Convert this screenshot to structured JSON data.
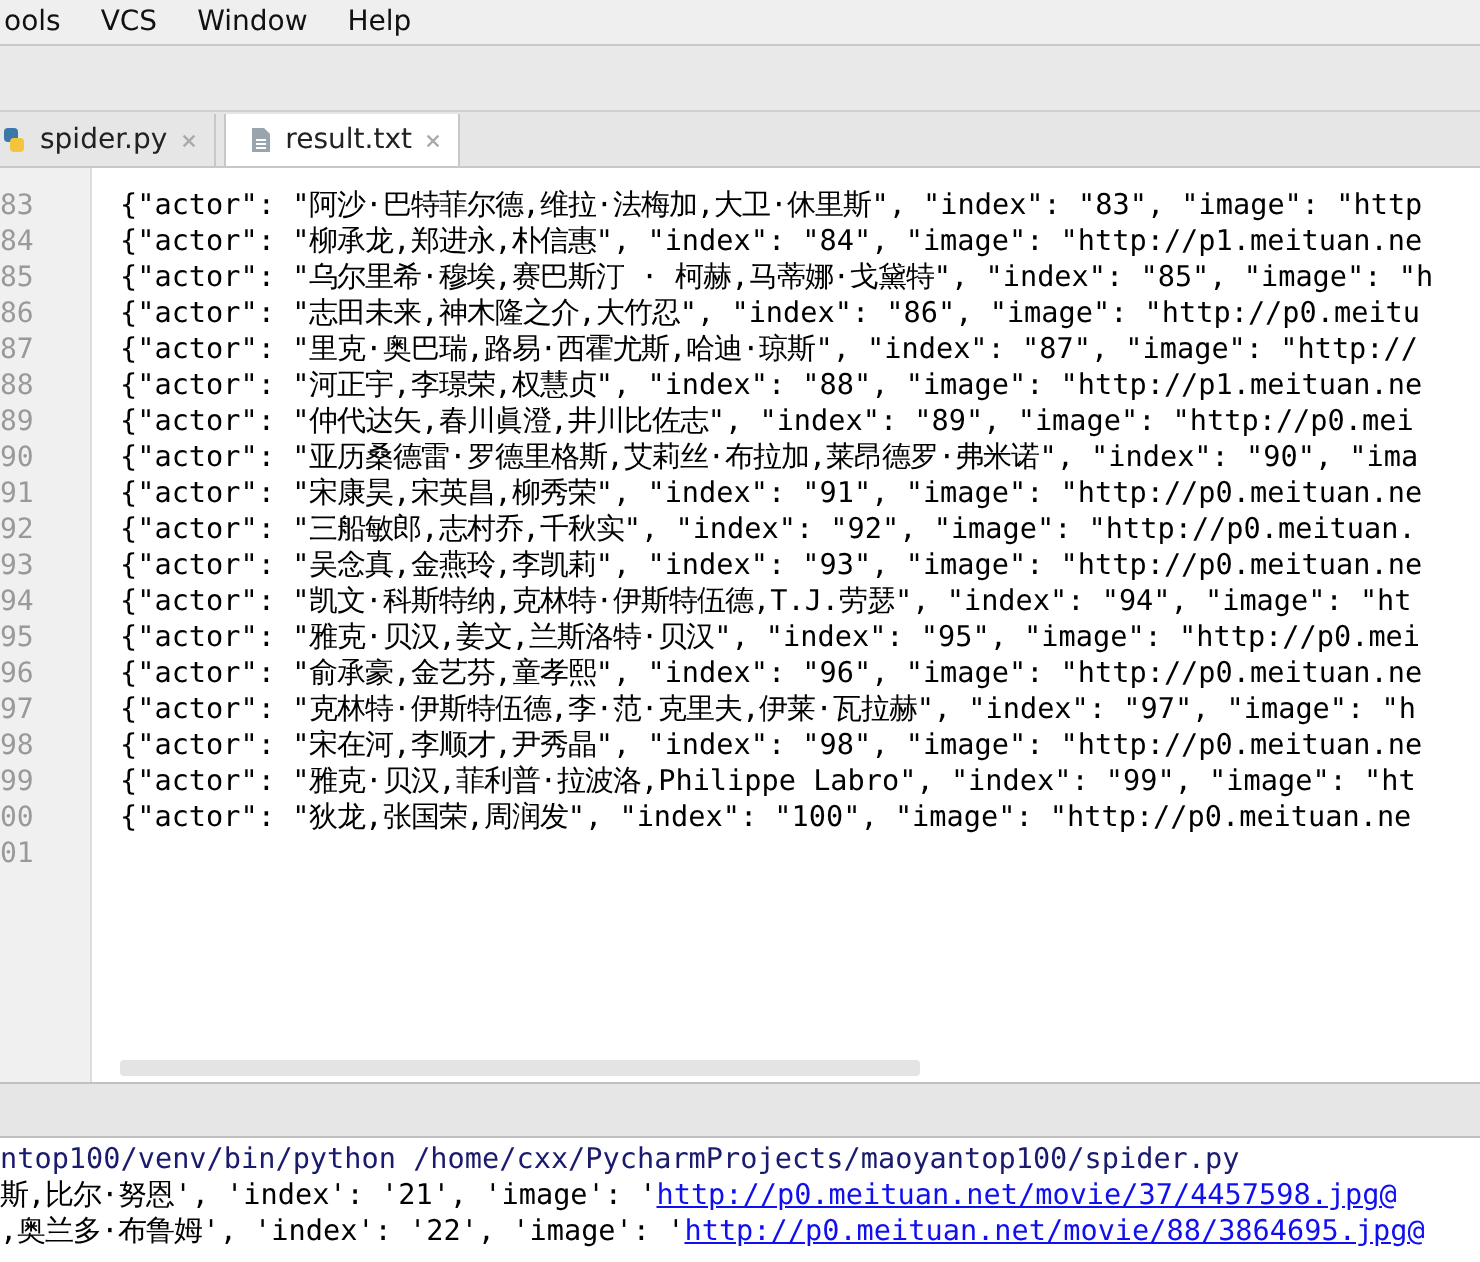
{
  "menu_bar": [
    "ools",
    "VCS",
    "Window",
    "Help"
  ],
  "tabs": [
    {
      "label": "spider.py",
      "kind": "python",
      "selected": false
    },
    {
      "label": "result.txt",
      "kind": "text",
      "selected": true
    }
  ],
  "editor": {
    "lines": [
      {
        "number": "83",
        "text": "{\"actor\": \"阿沙·巴特菲尔德,维拉·法梅加,大卫·休里斯\", \"index\": \"83\", \"image\": \"http"
      },
      {
        "number": "84",
        "text": "{\"actor\": \"柳承龙,郑进永,朴信惠\", \"index\": \"84\", \"image\": \"http://p1.meituan.ne"
      },
      {
        "number": "85",
        "text": "{\"actor\": \"乌尔里希·穆埃,赛巴斯汀 · 柯赫,马蒂娜·戈黛特\", \"index\": \"85\", \"image\": \"h"
      },
      {
        "number": "86",
        "text": "{\"actor\": \"志田未来,神木隆之介,大竹忍\", \"index\": \"86\", \"image\": \"http://p0.meitu"
      },
      {
        "number": "87",
        "text": "{\"actor\": \"里克·奥巴瑞,路易·西霍尤斯,哈迪·琼斯\", \"index\": \"87\", \"image\": \"http://"
      },
      {
        "number": "88",
        "text": "{\"actor\": \"河正宇,李璟荣,权慧贞\", \"index\": \"88\", \"image\": \"http://p1.meituan.ne"
      },
      {
        "number": "89",
        "text": "{\"actor\": \"仲代达矢,春川眞澄,井川比佐志\", \"index\": \"89\", \"image\": \"http://p0.mei"
      },
      {
        "number": "90",
        "text": "{\"actor\": \"亚历桑德雷·罗德里格斯,艾莉丝·布拉加,莱昂德罗·弗米诺\", \"index\": \"90\", \"ima"
      },
      {
        "number": "91",
        "text": "{\"actor\": \"宋康昊,宋英昌,柳秀荣\", \"index\": \"91\", \"image\": \"http://p0.meituan.ne"
      },
      {
        "number": "92",
        "text": "{\"actor\": \"三船敏郎,志村乔,千秋实\", \"index\": \"92\", \"image\": \"http://p0.meituan."
      },
      {
        "number": "93",
        "text": "{\"actor\": \"吴念真,金燕玲,李凯莉\", \"index\": \"93\", \"image\": \"http://p0.meituan.ne"
      },
      {
        "number": "94",
        "text": "{\"actor\": \"凯文·科斯特纳,克林特·伊斯特伍德,T.J.劳瑟\", \"index\": \"94\", \"image\": \"ht"
      },
      {
        "number": "95",
        "text": "{\"actor\": \"雅克·贝汉,姜文,兰斯洛特·贝汉\", \"index\": \"95\", \"image\": \"http://p0.mei"
      },
      {
        "number": "96",
        "text": "{\"actor\": \"俞承豪,金艺芬,童孝熙\", \"index\": \"96\", \"image\": \"http://p0.meituan.ne"
      },
      {
        "number": "97",
        "text": "{\"actor\": \"克林特·伊斯特伍德,李·范·克里夫,伊莱·瓦拉赫\", \"index\": \"97\", \"image\": \"h"
      },
      {
        "number": "98",
        "text": "{\"actor\": \"宋在河,李顺才,尹秀晶\", \"index\": \"98\", \"image\": \"http://p0.meituan.ne"
      },
      {
        "number": "99",
        "text": "{\"actor\": \"雅克·贝汉,菲利普·拉波洛,Philippe Labro\", \"index\": \"99\", \"image\": \"ht"
      },
      {
        "number": "00",
        "text": "{\"actor\": \"狄龙,张国荣,周润发\", \"index\": \"100\", \"image\": \"http://p0.meituan.ne"
      },
      {
        "number": "01"
      }
    ]
  },
  "run_console": {
    "lines": [
      {
        "kind": "command",
        "text": "ntop100/venv/bin/python /home/cxx/PycharmProjects/maoyantop100/spider.py"
      },
      {
        "kind": "output",
        "text": "斯,比尔·努恩', 'index': '21', 'image': '",
        "link": "http://p0.meituan.net/movie/37/4457598.jpg@"
      },
      {
        "kind": "output",
        "text": ",奥兰多·布鲁姆', 'index': '22', 'image': '",
        "link": "http://p0.meituan.net/movie/88/3864695.jpg@"
      }
    ]
  }
}
